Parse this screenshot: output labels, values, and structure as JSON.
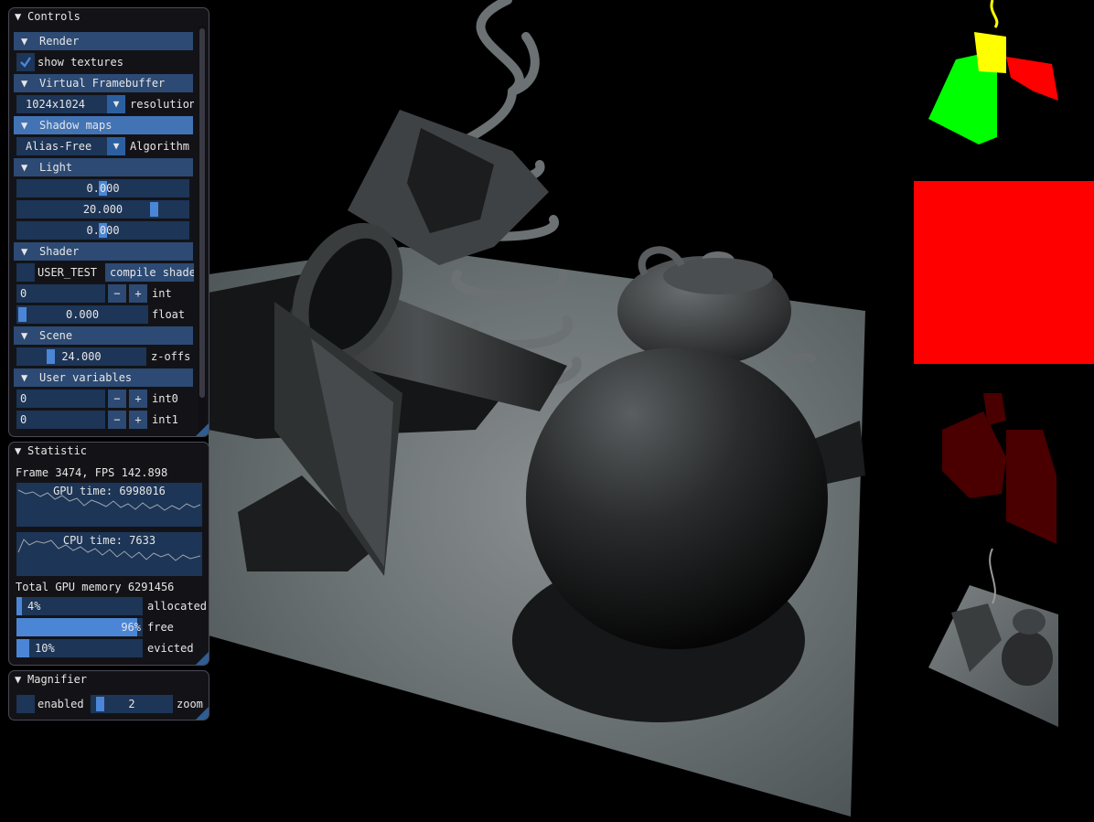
{
  "controls": {
    "title": "Controls",
    "render": {
      "header": "Render",
      "show_textures_label": "show textures",
      "show_textures_checked": true
    },
    "virtual_framebuffer": {
      "header": "Virtual Framebuffer",
      "resolution_value": "1024x1024",
      "resolution_label": "resolution"
    },
    "shadow_maps": {
      "header": "Shadow maps",
      "algorithm_value": "Alias-Free",
      "algorithm_label": "Algorithm"
    },
    "light": {
      "header": "Light",
      "sliders": [
        {
          "value": "0.000",
          "fraction": 0.5
        },
        {
          "value": "20.000",
          "fraction": 0.82
        },
        {
          "value": "0.000",
          "fraction": 0.5
        }
      ]
    },
    "shader": {
      "header": "Shader",
      "user_test_label": "USER_TEST",
      "compile_button": "compile shader",
      "int_value": "0",
      "int_label": "int",
      "float_value": "0.000",
      "float_label": "float",
      "minus": "−",
      "plus": "+"
    },
    "scene": {
      "header": "Scene",
      "z_offset_value": "24.000",
      "z_offset_label": "z-offset",
      "z_offset_fraction": 0.24
    },
    "user_variables": {
      "header": "User variables",
      "items": [
        {
          "value": "0",
          "label": "int0"
        },
        {
          "value": "0",
          "label": "int1"
        }
      ]
    }
  },
  "statistic": {
    "title": "Statistic",
    "frame_line": "Frame 3474, FPS 142.898",
    "gpu_plot_label": "GPU time: 6998016",
    "cpu_plot_label": "CPU time: 7633",
    "total_memory": "Total GPU memory 6291456",
    "bars": [
      {
        "value": "4%",
        "fraction": 0.04,
        "label": "allocated"
      },
      {
        "value": "96%",
        "fraction": 0.96,
        "label": "free"
      },
      {
        "value": "10%",
        "fraction": 0.1,
        "label": "evicted"
      }
    ]
  },
  "magnifier": {
    "title": "Magnifier",
    "enabled_label": "enabled",
    "zoom_value": "2",
    "zoom_label": "zoom",
    "zoom_fraction": 0.05
  },
  "colors": {
    "accent": "#4b86d6",
    "header": "#2c4a73",
    "header_active": "#4273b5",
    "frame_bg": "#1d3556",
    "debug_red": "#ff0000"
  },
  "icons": {
    "collapse": "triangle-down-icon",
    "combo": "chevron-down-icon",
    "check": "check-icon"
  }
}
